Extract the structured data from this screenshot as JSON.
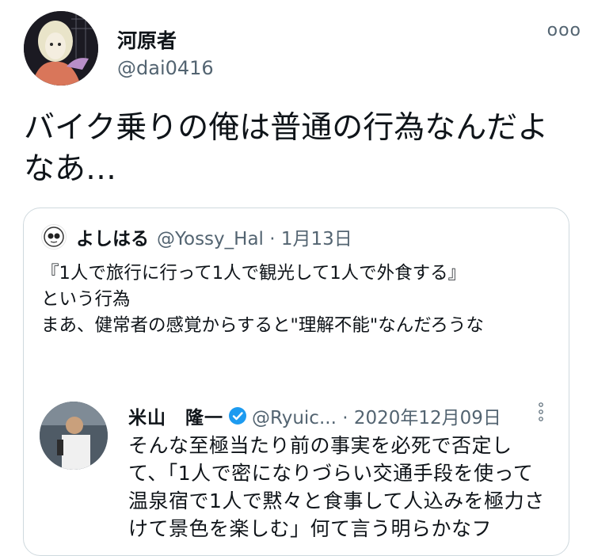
{
  "tweet": {
    "display_name": "河原者",
    "handle": "@dai0416",
    "more_label": "ooo",
    "text": "バイク乗りの俺は普通の行為なんだよなあ…"
  },
  "quote": {
    "display_name": "よしはる",
    "meta": "@Yossy_Hal · 1月13日",
    "text": "『1人で旅行に行って1人で観光して1人で外食する』\nという行為\nまあ、健常者の感覚からすると\"理解不能\"なんだろうな"
  },
  "inner_quote": {
    "display_name": "米山　隆一",
    "meta": "@Ryuic... · 2020年12月09日",
    "text": "そんな至極当たり前の事実を必死で否定して、「1人で密になりづらい交通手段を使って温泉宿で1人で黙々と食事して人込みを極力さけて景色を楽しむ」何て言う明らかなフ",
    "verified_color": "#1d9bf0"
  },
  "icons": [
    "more-icon",
    "verified-icon",
    "dots-vertical-icon"
  ]
}
